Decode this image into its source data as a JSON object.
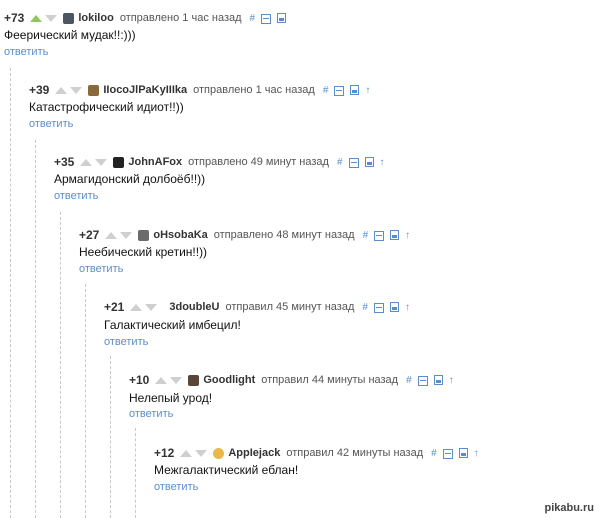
{
  "comments": [
    {
      "score": "+73",
      "author": "lokiloo",
      "time": "отправлено 1 час назад",
      "text": "Феерический мудак!!:)))",
      "reply": "ответить",
      "actions": [
        "#",
        "⊟",
        "⊞"
      ],
      "upvoted": true,
      "avatar_color": "#4b5563"
    },
    {
      "score": "+39",
      "author": "IIocoJlPaKyIIIka",
      "time": "отправлено 1 час назад",
      "text": "Катастрофический идиот!!))",
      "reply": "ответить",
      "actions": [
        "#",
        "⊟",
        "⊞",
        "↑"
      ],
      "upvoted": false,
      "avatar_color": "#8a6a3a"
    },
    {
      "score": "+35",
      "author": "JohnAFox",
      "time": "отправлено 49 минут назад",
      "text": "Армагидонский долбоёб!!))",
      "reply": "ответить",
      "actions": [
        "#",
        "⊟",
        "⊞",
        "↑"
      ],
      "upvoted": false,
      "avatar_color": "#222222"
    },
    {
      "score": "+27",
      "author": "oHsobaKa",
      "time": "отправлено 48 минут назад",
      "text": "Неебический кретин!!))",
      "reply": "ответить",
      "actions": [
        "#",
        "⊟",
        "⊞",
        "↑"
      ],
      "upvoted": false,
      "avatar_color": "#6b6b6b"
    },
    {
      "score": "+21",
      "author": "3doubleU",
      "time": "отправил 45 минут назад",
      "text": "Галактический имбецил!",
      "reply": "ответить",
      "actions": [
        "#",
        "⊟",
        "⊞",
        "↑"
      ],
      "upvoted": false,
      "avatar_color": ""
    },
    {
      "score": "+10",
      "author": "Goodlight",
      "time": "отправил 44 минуты назад",
      "text": "Нелепый урод!",
      "reply": "ответить",
      "actions": [
        "#",
        "⊟",
        "⊞",
        "↑"
      ],
      "upvoted": false,
      "avatar_color": "#5a4636"
    },
    {
      "score": "+12",
      "author": "AppIejack",
      "time": "отправил 42 минуты назад",
      "text": "Межгалактический еблан!",
      "reply": "ответить",
      "actions": [
        "#",
        "⊟",
        "⊞",
        "↑"
      ],
      "upvoted": false,
      "avatar_color": "#e8b84a"
    }
  ],
  "watermark": "pikabu.ru",
  "colors": {
    "link": "#5b8dc9",
    "upvote_active": "#8fc85a",
    "vote_inactive": "#cfcfcf",
    "indent_line": "#c8c8c8"
  }
}
